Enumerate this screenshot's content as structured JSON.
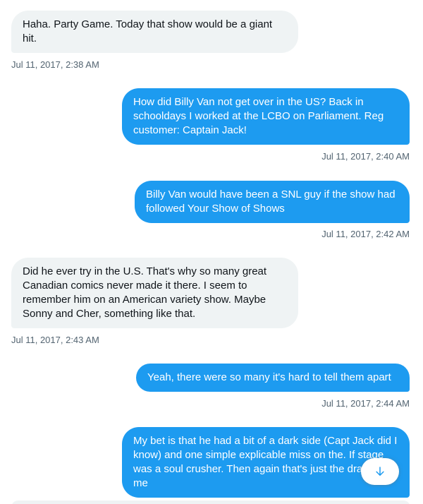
{
  "colors": {
    "incoming_bubble": "#eff3f4",
    "outgoing_bubble": "#1d9bf0",
    "timestamp": "#536471",
    "scroll_arrow": "#1d9bf0"
  },
  "messages": [
    {
      "direction": "incoming",
      "text": "Haha. Party Game. Today that show would be a giant hit.",
      "time": "Jul 11, 2017, 2:38 AM"
    },
    {
      "direction": "outgoing",
      "text": "How did Billy Van not get over in the US? Back in schooldays I worked at the LCBO on Parliament. Reg customer: Captain Jack!",
      "time": "Jul 11, 2017, 2:40 AM"
    },
    {
      "direction": "outgoing",
      "text": "Billy Van would have been a SNL guy if the show had followed Your Show of Shows",
      "time": "Jul 11, 2017, 2:42 AM"
    },
    {
      "direction": "incoming",
      "text": "Did he ever try in the U.S. That's why so many great Canadian comics never made it there. I seem to remember him on an American variety show. Maybe Sonny and Cher, something like that.",
      "time": "Jul 11, 2017, 2:43 AM"
    },
    {
      "direction": "outgoing",
      "text": "Yeah, there were so many it's hard to tell them apart",
      "time": "Jul 11, 2017, 2:44 AM"
    },
    {
      "direction": "outgoing",
      "text": "My bet is that he had a bit of a dark side (Capt Jack did I know) and one simple explicable miss on the. If stage was a soul crusher. Then again that's just the drama in me",
      "time": ""
    }
  ],
  "scroll_down_icon": "arrow-down-icon"
}
